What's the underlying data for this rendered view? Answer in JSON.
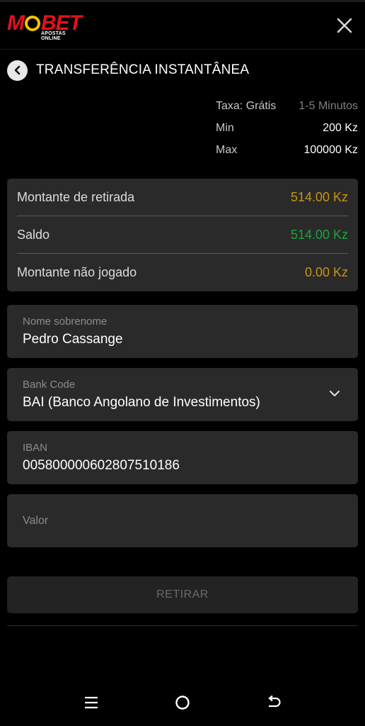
{
  "header": {
    "logo_text_left": "M",
    "logo_text_right": "BET",
    "logo_subtitle": "APOSTAS ONLINE",
    "close_icon": "close-icon"
  },
  "page": {
    "back_icon": "chevron-left-icon",
    "title": "TRANSFERÊNCIA INSTANTÂNEA"
  },
  "info": {
    "fee_label": "Taxa: Grátis",
    "fee_time": "1-5 Minutos",
    "min_label": "Min",
    "min_value": "200 Kz",
    "max_label": "Max",
    "max_value": "100000 Kz"
  },
  "summary": {
    "withdraw_label": "Montante de retirada",
    "withdraw_value": "514.00 Kz",
    "balance_label": "Saldo",
    "balance_value": "514.00 Kz",
    "unplayed_label": "Montante não jogado",
    "unplayed_value": "0.00 Kz"
  },
  "form": {
    "name_label": "Nome sobrenome",
    "name_value": "Pedro Cassange",
    "bank_label": "Bank Code",
    "bank_value": "BAI (Banco Angolano de Investimentos)",
    "iban_label": "IBAN",
    "iban_value": "005800000602807510186",
    "amount_placeholder": "Valor"
  },
  "submit_label": "RETIRAR",
  "colors": {
    "brand_red": "#e3101c",
    "brand_yellow": "#f3c400",
    "gold_value": "#c99410",
    "green_value": "#1ea33a"
  },
  "navbar": {
    "recent_icon": "menu-lines-icon",
    "home_icon": "home-circle-icon",
    "back_icon": "back-arrow-icon"
  }
}
